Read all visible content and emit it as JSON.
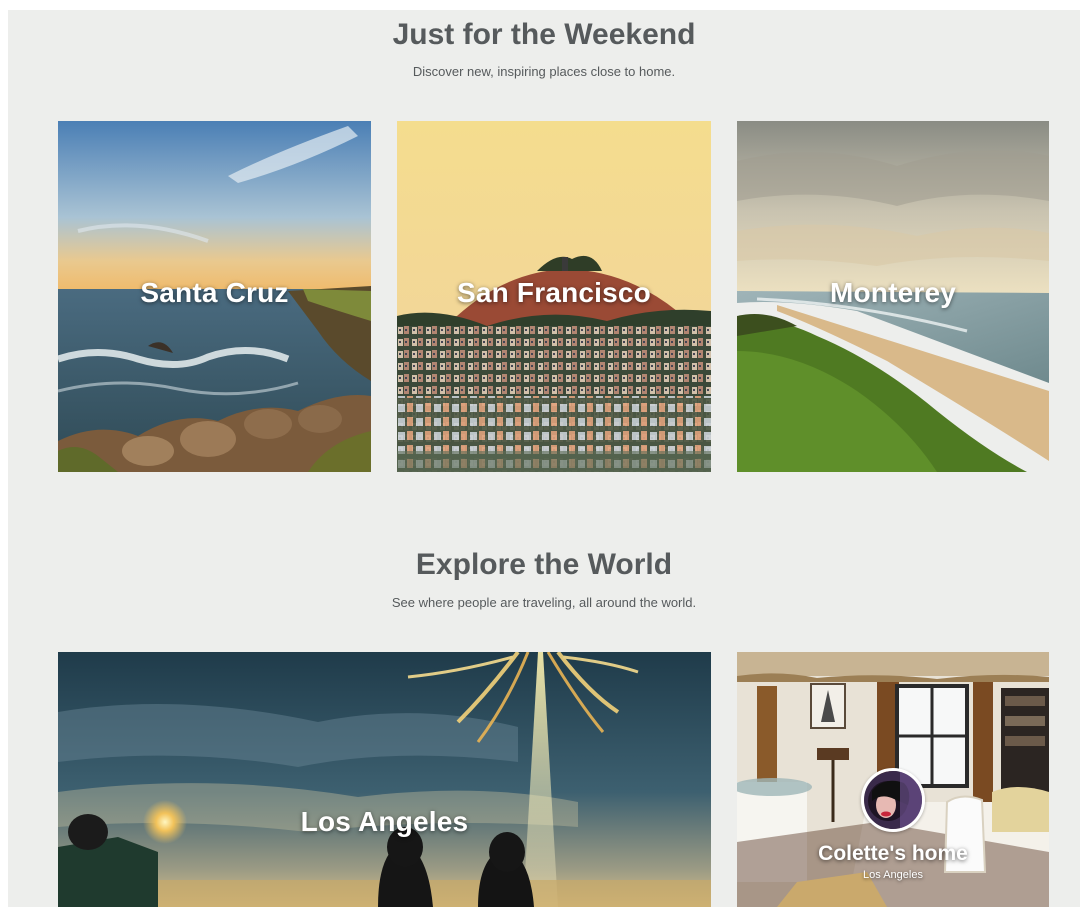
{
  "sections": {
    "weekend": {
      "title": "Just for the Weekend",
      "subtitle": "Discover new, inspiring places close to home."
    },
    "world": {
      "title": "Explore the World",
      "subtitle": "See where people are traveling, all around the world."
    }
  },
  "weekend_cards": [
    {
      "label": "Santa Cruz"
    },
    {
      "label": "San Francisco"
    },
    {
      "label": "Monterey"
    }
  ],
  "world_cards": {
    "los_angeles": {
      "label": "Los Angeles"
    },
    "home": {
      "label": "Colette's home",
      "location": "Los Angeles"
    }
  }
}
